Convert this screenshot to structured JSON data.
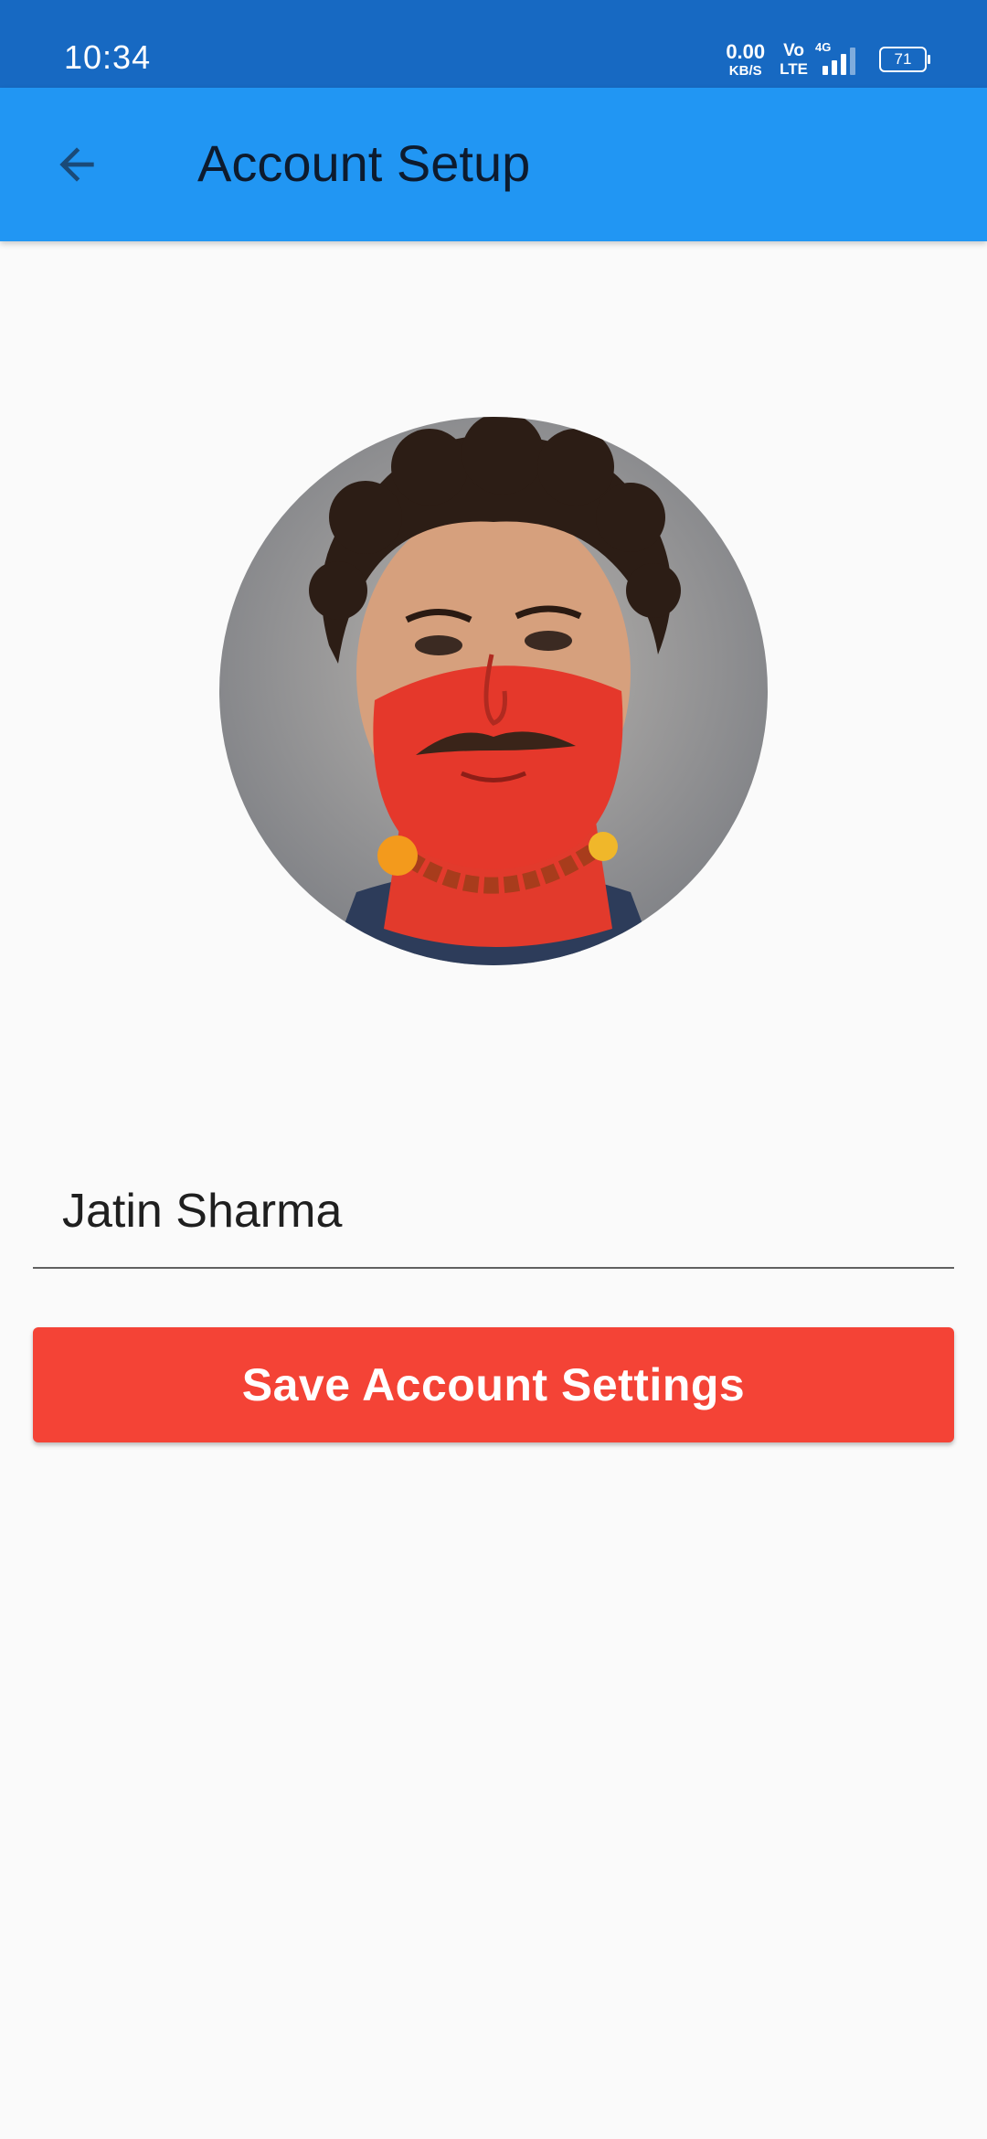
{
  "status_bar": {
    "time": "10:34",
    "net_speed_value": "0.00",
    "net_speed_unit": "KB/S",
    "volte_top": "Vo",
    "volte_bottom": "LTE",
    "network_type": "4G",
    "signal_level": 3,
    "battery_level": "71",
    "background_color": "#1769c2"
  },
  "app_bar": {
    "title": "Account Setup",
    "back_icon": "arrow-back-icon",
    "background_color": "#2196f3"
  },
  "profile": {
    "avatar_icon": "profile-photo",
    "name_value": "Jatin Sharma"
  },
  "actions": {
    "save_label": "Save Account Settings",
    "save_color": "#f44336"
  }
}
